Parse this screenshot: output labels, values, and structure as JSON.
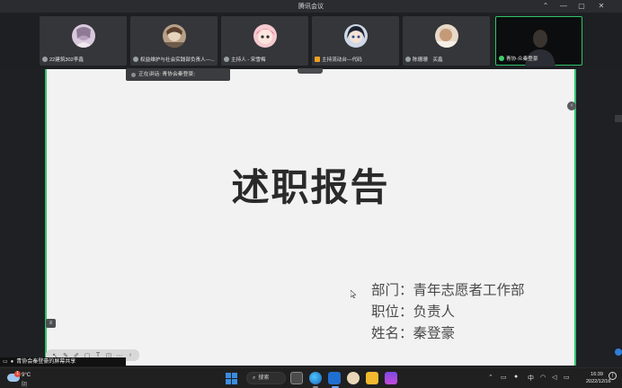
{
  "window": {
    "title": "腾讯会议",
    "controls": [
      "—",
      "▢",
      "✕"
    ],
    "extra_icon": "fullscreen-icon"
  },
  "participants": [
    {
      "name": "22建筑302李鑫",
      "mic": "off"
    },
    {
      "name": "权益维护与社会实践部负责人—...",
      "mic": "off"
    },
    {
      "name": "主持人 - 宋雪梅",
      "mic": "off"
    },
    {
      "name": "主持流动台—代码",
      "mic": "host"
    },
    {
      "name": "陈珊珊　买鑫",
      "mic": "off"
    },
    {
      "name": "青协-众秦登豪",
      "mic": "on"
    }
  ],
  "speaking": {
    "label": "正在讲话: 青协会秦登豪;"
  },
  "slide": {
    "title": "述职报告",
    "lines": [
      "部门：青年志愿者工作部",
      "职位：负责人",
      "姓名：秦登豪"
    ]
  },
  "share_notice": {
    "text": "青协会秦登豪的屏幕共享"
  },
  "taskbar": {
    "weather_temp": "9°C",
    "weather_cond": "阴",
    "weather_badge": "1",
    "search_label": "搜索",
    "ime": "中",
    "time": "16:39",
    "date": "2022/12/16"
  },
  "colors": {
    "share_border": "#2fc46b",
    "accent": "#3a8de0"
  }
}
